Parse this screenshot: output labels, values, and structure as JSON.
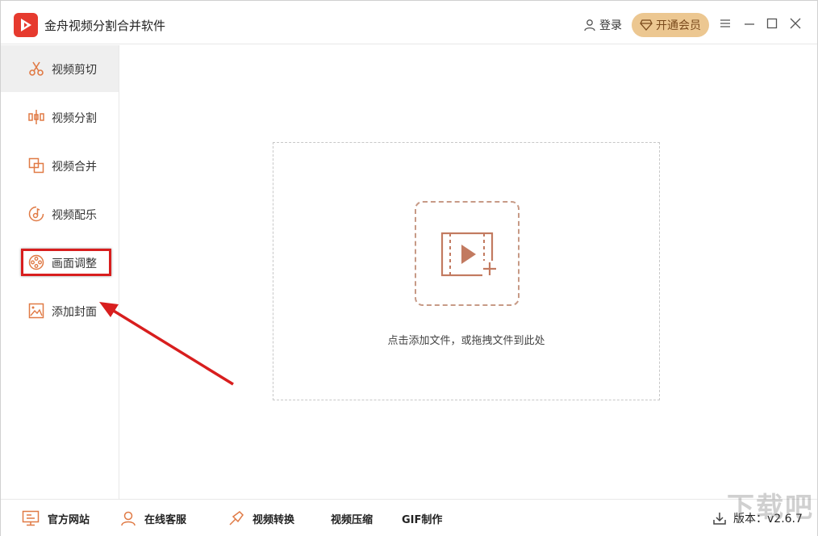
{
  "app": {
    "title": "金舟视频分割合并软件",
    "login_label": "登录",
    "vip_label": "开通会员"
  },
  "sidebar": {
    "items": [
      {
        "label": "视频剪切",
        "icon": "scissors-icon",
        "active": true
      },
      {
        "label": "视频分割",
        "icon": "split-icon"
      },
      {
        "label": "视频合并",
        "icon": "merge-icon"
      },
      {
        "label": "视频配乐",
        "icon": "music-icon"
      },
      {
        "label": "画面调整",
        "icon": "film-reel-icon",
        "highlighted": true
      },
      {
        "label": "添加封面",
        "icon": "image-icon"
      }
    ]
  },
  "main": {
    "drop_text": "点击添加文件，或拖拽文件到此处"
  },
  "bottom": {
    "website": "官方网站",
    "service": "在线客服",
    "convert": "视频转换",
    "compress": "视频压缩",
    "gif": "GIF制作",
    "version": "版本：v2.6.7"
  },
  "watermark": "下载吧",
  "colors": {
    "accent": "#e07a45",
    "logo": "#e63a2e",
    "vip": "#ecc791",
    "highlight": "#d81e1e"
  }
}
